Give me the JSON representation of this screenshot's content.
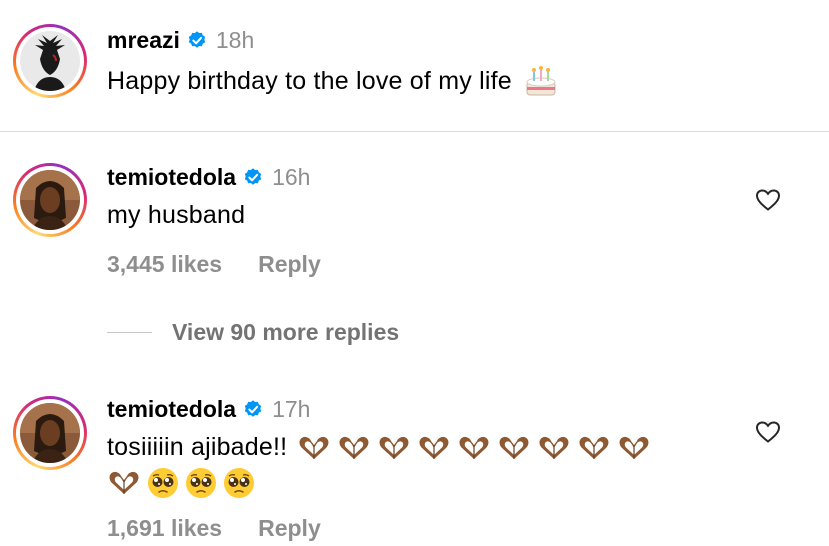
{
  "caption": {
    "username": "mreazi",
    "time": "18h",
    "text": "Happy birthday to the love of my life",
    "emoji": "birthday-cake-icon"
  },
  "comments": [
    {
      "username": "temiotedola",
      "time": "16h",
      "text": "my husband",
      "likes": "3,445 likes",
      "reply": "Reply"
    },
    {
      "username": "temiotedola",
      "time": "17h",
      "text": "tosiiiiin ajibade!!",
      "likes": "1,691 likes",
      "reply": "Reply",
      "emojis_line1": [
        "heart-hands",
        "heart-hands",
        "heart-hands",
        "heart-hands",
        "heart-hands",
        "heart-hands",
        "heart-hands",
        "heart-hands",
        "heart-hands"
      ],
      "emojis_line2": [
        "heart-hands",
        "pleading-face",
        "pleading-face",
        "pleading-face"
      ]
    }
  ],
  "view_more": "View 90 more replies",
  "colors": {
    "verified": "#0095f6",
    "muted": "#8e8e8e",
    "divider": "#dbdbdb"
  }
}
